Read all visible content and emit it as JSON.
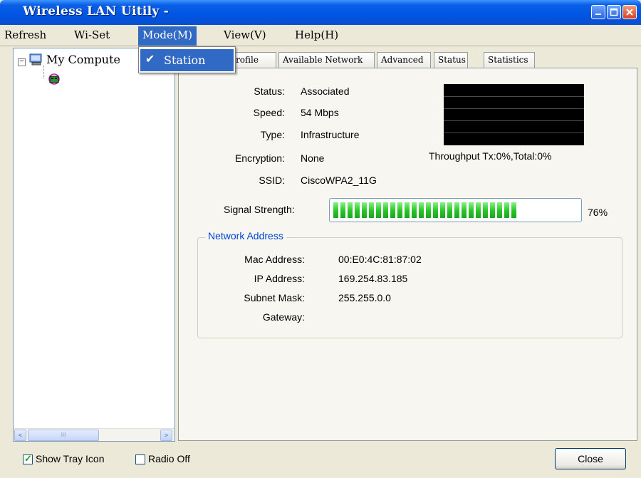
{
  "window": {
    "title": "Wireless LAN Uitily -",
    "buttons": [
      "minimize",
      "maximize",
      "close"
    ]
  },
  "menubar": {
    "items": [
      "Refresh",
      "Wi-Set",
      "Mode(M)",
      "View(V)",
      "Help(H)"
    ],
    "active": "Mode(M)"
  },
  "mode_menu": {
    "items": [
      {
        "label": "Station",
        "checked": true
      }
    ]
  },
  "tree": {
    "root_label": "My Compute",
    "expander": "minus",
    "icons": [
      "computer-icon",
      "network-adapter-icon"
    ]
  },
  "tabs": [
    "Profile",
    "Available Network",
    "Advanced",
    "Status",
    "Statistics"
  ],
  "status": {
    "status_label": "Status:",
    "status_value": "Associated",
    "speed_label": "Speed:",
    "speed_value": "54 Mbps",
    "type_label": "Type:",
    "type_value": "Infrastructure",
    "encryption_label": "Encryption:",
    "encryption_value": "None",
    "ssid_label": "SSID:",
    "ssid_value": "CiscoWPA2_11G",
    "throughput_text": "Throughput Tx:0%,Total:0%",
    "signal_label": "Signal Strength:",
    "signal_percent_text": "76%",
    "signal_fraction": 0.76
  },
  "network_address": {
    "title": "Network Address",
    "mac_label": "Mac Address:",
    "mac_value": "00:E0:4C:81:87:02",
    "ip_label": "IP Address:",
    "ip_value": "169.254.83.185",
    "subnet_label": "Subnet Mask:",
    "subnet_value": "255.255.0.0",
    "gateway_label": "Gateway:",
    "gateway_value": ""
  },
  "footer": {
    "show_tray_icon_label": "Show Tray Icon",
    "show_tray_icon_checked": true,
    "radio_off_label": "Radio Off",
    "radio_off_checked": false,
    "close_label": "Close"
  },
  "scrollbar": {
    "left_arrow": "<",
    "right_arrow": ">",
    "thumb_grip": "III"
  },
  "colors": {
    "title_blue": "#0054e3",
    "menu_highlight": "#316ac5",
    "signal_green": "#27c427",
    "group_title": "#0046d5"
  }
}
